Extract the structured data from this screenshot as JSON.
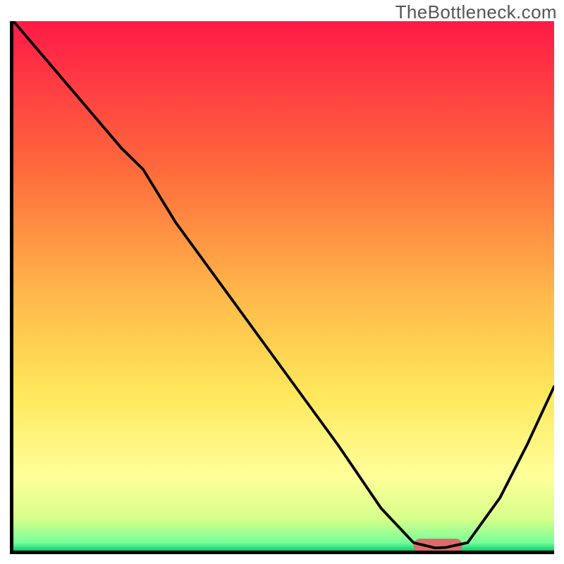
{
  "watermark": "TheBottleneck.com",
  "chart_data": {
    "type": "line",
    "title": "",
    "xlabel": "",
    "ylabel": "",
    "xlim": [
      0,
      100
    ],
    "ylim": [
      0,
      100
    ],
    "grid": false,
    "legend": false,
    "background": {
      "kind": "vertical-gradient",
      "stops": [
        {
          "pos": 0.0,
          "color": "#ff1a47"
        },
        {
          "pos": 0.28,
          "color": "#ff6a3c"
        },
        {
          "pos": 0.52,
          "color": "#ffb94a"
        },
        {
          "pos": 0.7,
          "color": "#ffe75a"
        },
        {
          "pos": 0.86,
          "color": "#ffff9a"
        },
        {
          "pos": 0.94,
          "color": "#d6ff8a"
        },
        {
          "pos": 0.985,
          "color": "#77ff9a"
        },
        {
          "pos": 1.0,
          "color": "#05d070"
        }
      ]
    },
    "series": [
      {
        "name": "bottleneck-curve",
        "color": "#000000",
        "x": [
          0.0,
          10.0,
          20.0,
          24.0,
          30.0,
          40.0,
          50.0,
          60.0,
          68.0,
          74.0,
          78.0,
          80.0,
          84.0,
          90.0,
          95.0,
          100.0
        ],
        "y": [
          100.0,
          88.0,
          76.0,
          72.0,
          62.0,
          48.0,
          34.0,
          20.0,
          8.0,
          1.5,
          0.5,
          0.6,
          1.5,
          10.0,
          20.0,
          31.0
        ]
      }
    ],
    "marker": {
      "name": "optimal-range",
      "color": "#dd6b6b",
      "x_start": 74.0,
      "x_end": 83.0,
      "y": 1.0,
      "thickness": 2.5
    }
  },
  "gradient_id": "heat-gradient"
}
